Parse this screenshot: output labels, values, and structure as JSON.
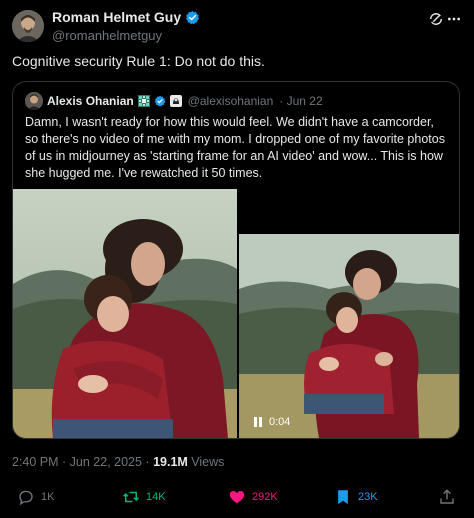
{
  "author": {
    "name": "Roman Helmet Guy",
    "handle": "@romanhelmetguy"
  },
  "tweet_text": "Cognitive security Rule 1: Do not do this.",
  "quote": {
    "name": "Alexis Ohanian",
    "handle": "@alexisohanian",
    "date": "· Jun 22",
    "text": "Damn, I wasn't ready for how this would feel. We didn't have a camcorder, so there's no video of me with my mom. I dropped one of my favorite photos of us in midjourney as 'starting frame for an AI video' and wow... This is how she hugged me. I've rewatched it 50 times.",
    "video_time": "0:04"
  },
  "meta": {
    "timestamp": "2:40 PM · Jun 22, 2025 · ",
    "views_count": "19.1M",
    "views_label": " Views"
  },
  "actions": {
    "reply": "1K",
    "retweet": "14K",
    "like": "292K",
    "bookmark": "23K"
  },
  "colors": {
    "background": "#000000",
    "verified": "#1d9bf0",
    "retweet": "#00ba7c",
    "like": "#f91880",
    "bookmark": "#1d9bf0",
    "muted": "#71767b"
  },
  "icons": [
    "verified-badge-icon",
    "grok-icon",
    "more-icon",
    "pause-icon",
    "reply-icon",
    "retweet-icon",
    "like-icon",
    "bookmark-icon",
    "share-icon"
  ]
}
